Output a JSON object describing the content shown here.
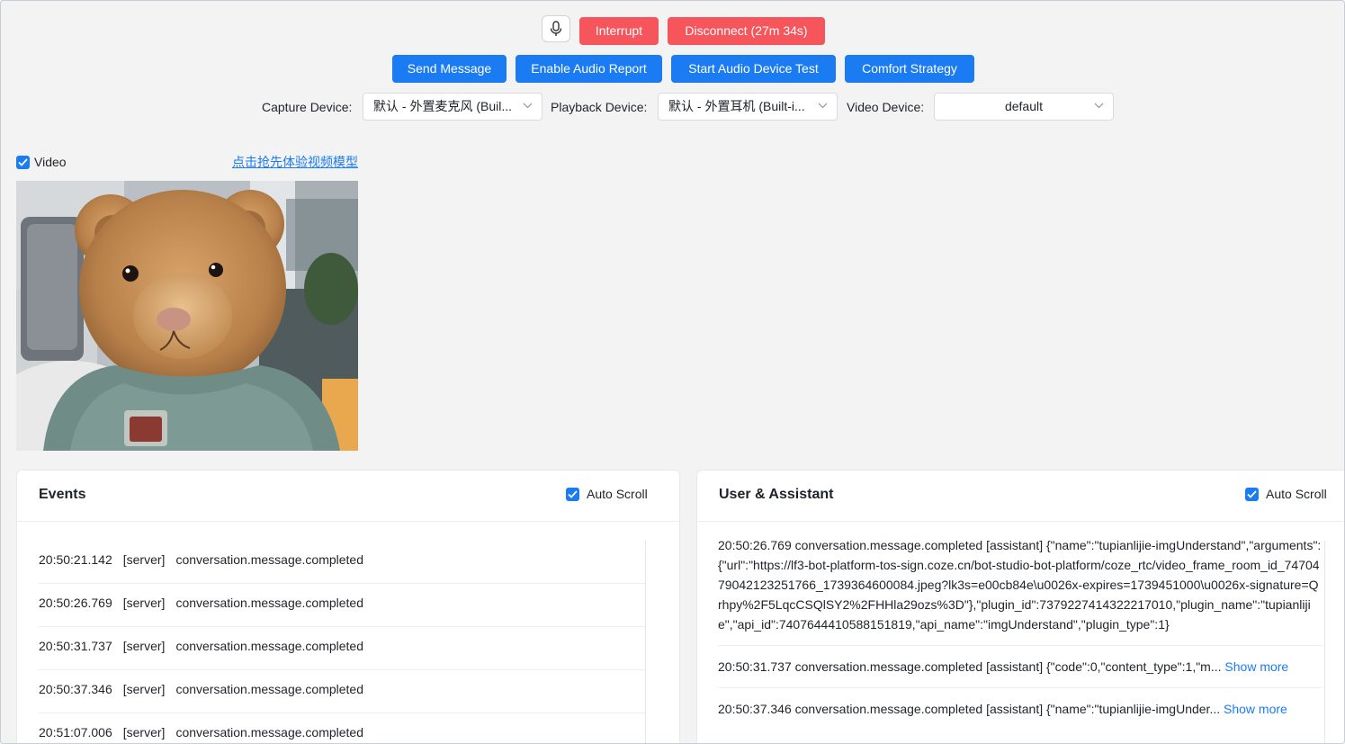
{
  "toolbar": {
    "interrupt_label": "Interrupt",
    "disconnect_label": "Disconnect (27m 34s)",
    "send_message_label": "Send Message",
    "enable_audio_report_label": "Enable Audio Report",
    "start_audio_test_label": "Start Audio Device Test",
    "comfort_strategy_label": "Comfort Strategy"
  },
  "devices": {
    "capture_label": "Capture Device:",
    "capture_value": "默认 - 外置麦克风 (Buil...",
    "playback_label": "Playback Device:",
    "playback_value": "默认 - 外置耳机 (Built-i...",
    "video_label": "Video Device:",
    "video_value": "default"
  },
  "video": {
    "checkbox_label": "Video",
    "link_text": "点击抢先体验视频模型"
  },
  "events_panel": {
    "title": "Events",
    "auto_scroll_label": "Auto Scroll",
    "rows": [
      {
        "time": "20:50:21.142",
        "source": "[server]",
        "event": "conversation.message.completed"
      },
      {
        "time": "20:50:26.769",
        "source": "[server]",
        "event": "conversation.message.completed"
      },
      {
        "time": "20:50:31.737",
        "source": "[server]",
        "event": "conversation.message.completed"
      },
      {
        "time": "20:50:37.346",
        "source": "[server]",
        "event": "conversation.message.completed"
      },
      {
        "time": "20:51:07.006",
        "source": "[server]",
        "event": "conversation.message.completed"
      }
    ]
  },
  "ua_panel": {
    "title": "User & Assistant",
    "auto_scroll_label": "Auto Scroll",
    "long_message": "20:50:26.769  conversation.message.completed [assistant] {\"name\":\"tupianlijie-imgUnderstand\",\"arguments\":{\"url\":\"https://lf3-bot-platform-tos-sign.coze.cn/bot-studio-bot-platform/coze_rtc/video_frame_room_id_7470479042123251766_1739364600084.jpeg?lk3s=e00cb84e\\u0026x-expires=1739451000\\u0026x-signature=Qrhpy%2F5LqcCSQlSY2%2FHHla29ozs%3D\"},\"plugin_id\":7379227414322217010,\"plugin_name\":\"tupianlijie\",\"api_id\":7407644410588151819,\"api_name\":\"imgUnderstand\",\"plugin_type\":1}",
    "row2_text": "20:50:31.737  conversation.message.completed [assistant] {\"code\":0,\"content_type\":1,\"m...",
    "row3_text": "20:50:37.346  conversation.message.completed [assistant] {\"name\":\"tupianlijie-imgUnder...",
    "show_more_label": "Show more"
  },
  "colors": {
    "primary_blue": "#1a7bf2",
    "danger_red": "#f5555b",
    "background": "#f3f3f3"
  },
  "icons": [
    "microphone-icon",
    "chevron-down-icon",
    "checkbox-checked-icon"
  ]
}
